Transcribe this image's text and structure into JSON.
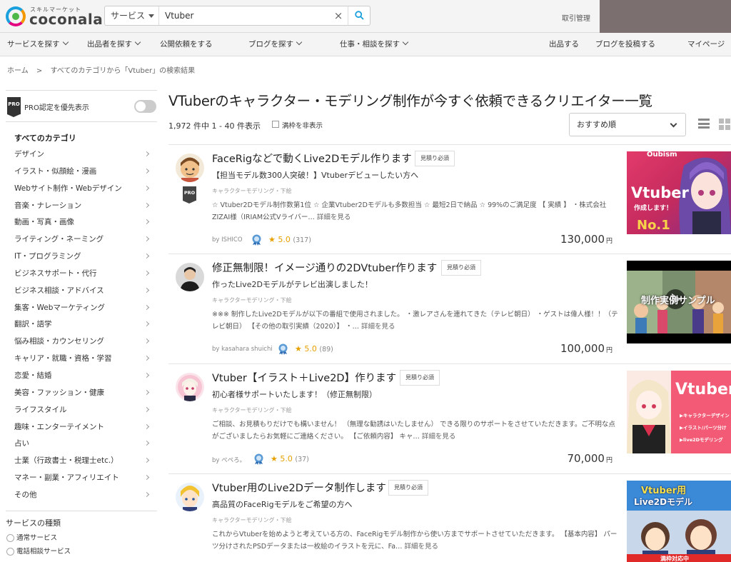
{
  "header": {
    "logo_tagline": "スキルマーケット",
    "logo_name": "coconala",
    "search_category": "サービス",
    "search_query": "Vtuber",
    "clear_symbol": "×",
    "deal_link": "取引管理"
  },
  "nav": {
    "items": [
      "サービスを探す",
      "出品者を探す",
      "公開依頼をする",
      "ブログを探す",
      "仕事・相談を探す"
    ],
    "right_items": [
      "出品する",
      "ブログを投稿する",
      "マイページ"
    ]
  },
  "breadcrumb": [
    "ホーム",
    ">",
    "すべてのカテゴリから「Vtuber」の検索結果"
  ],
  "sidebar": {
    "pro_badge": "PRO",
    "pro_label": "PRO認定を優先表示",
    "pro_toggle_on": false,
    "category_title": "すべてのカテゴリ",
    "categories": [
      "デザイン",
      "イラスト・似顔絵・漫画",
      "Webサイト制作・Webデザイン",
      "音楽・ナレーション",
      "動画・写真・画像",
      "ライティング・ネーミング",
      "IT・プログラミング",
      "ビジネスサポート・代行",
      "ビジネス相談・アドバイス",
      "集客・Webマーケティング",
      "翻訳・語学",
      "悩み相談・カウンセリング",
      "キャリア・就職・資格・学習",
      "恋愛・結婚",
      "美容・ファッション・健康",
      "ライフスタイル",
      "趣味・エンターテイメント",
      "占い",
      "士業（行政書士・税理士etc.）",
      "マネー・副業・アフィリエイト",
      "その他"
    ],
    "service_type_title": "サービスの種類",
    "service_types": [
      "通常サービス",
      "電話相談サービス"
    ]
  },
  "main": {
    "title": "VTuberのキャラクター・モデリング制作が今すぐ依頼できるクリエイター一覧",
    "result_count": "1,972 件中 1 - 40 件表示",
    "hide_full_label": "満枠を非表示",
    "sort_value": "おすすめ順"
  },
  "listings": [
    {
      "title": "FaceRigなどで動くLive2Dモデル作ります",
      "estimate": "見積り必須",
      "subtitle": "【担当モデル数300人突破！】Vtuberデビューしたい方へ",
      "category": "キャラクターモデリング・下絵",
      "description": "☆ Vtuber2Dモデル制作数第1位 ☆ 企業Vtuber2Dモデルも多数担当 ☆ 最短2日で納品 ☆ 99%のご満足度 【 実績 】 ・株式会社ZIZAI様（IRIAM公式Vライバー…",
      "more": "詳細を見る",
      "seller": "by ISHICO",
      "rating": "5.0",
      "reviews": "(317)",
      "price": "130,000",
      "yen": "円",
      "pro": "PRO",
      "thumb_lines": [
        "Oubism",
        "Vtuber",
        "作成します！",
        "No.1"
      ]
    },
    {
      "title": "修正無制限！イメージ通りの2DVtuber作ります",
      "estimate": "見積り必須",
      "subtitle": "作ったLive2Dモデルがテレビ出演しました！",
      "category": "キャラクターモデリング・下絵",
      "description": "※※※ 制作したLive2Dモデルが以下の番組で使用されました。 ・激レアさんを連れてきた（テレビ朝日） ・ゲストは偉人様！！（テレビ朝日） 【その他の取引実績（2020）】 ・…",
      "more": "詳細を見る",
      "seller": "by kasahara shuichi",
      "rating": "5.0",
      "reviews": "(89)",
      "price": "100,000",
      "yen": "円",
      "pro": "",
      "thumb_lines": [
        "制作実例サンプル"
      ]
    },
    {
      "title": "Vtuber【イラスト＋Live2D】作ります",
      "estimate": "見積り必須",
      "subtitle": "初心者様サポートいたします！（修正無制限）",
      "category": "キャラクターモデリング・下絵",
      "description": "ご相談、お見積もりだけでも構いません！ （無理な勧誘はいたしません） できる限りのサポートをさせていただきます。ご不明な点がございましたらお気軽にご連絡ください。 【ご依頼内容】 キャ…",
      "more": "詳細を見る",
      "seller": "by ぺペろ。",
      "rating": "5.0",
      "reviews": "(37)",
      "price": "70,000",
      "yen": "円",
      "pro": "",
      "thumb_lines": [
        "Vtuber",
        "▶キャラクターデザイン",
        "▶イラスト/パーツ分け",
        "▶live2Dモデリング"
      ]
    },
    {
      "title": "Vtuber用のLive2Dデータ制作します",
      "estimate": "見積り必須",
      "subtitle": "高品質のFaceRigモデルをご希望の方へ",
      "category": "キャラクターモデリング・下絵",
      "description": "これからVtuberを始めようと考えている方の、FaceRigモデル制作から使い方までサポートさせていただきます。 【基本内容】 パーツ分けされたPSDデータまたは一枚絵のイラストを元に、Fa…",
      "more": "詳細を見る",
      "seller": "",
      "rating": "",
      "reviews": "",
      "price": "",
      "yen": "",
      "pro": "",
      "thumb_lines": [
        "Vtuber用",
        "Live2Dモデル",
        "満枠対応中"
      ]
    }
  ],
  "colors": {
    "accent_blue": "#1aa0dd",
    "star": "#e6a100",
    "pro_badge": "#333333"
  }
}
